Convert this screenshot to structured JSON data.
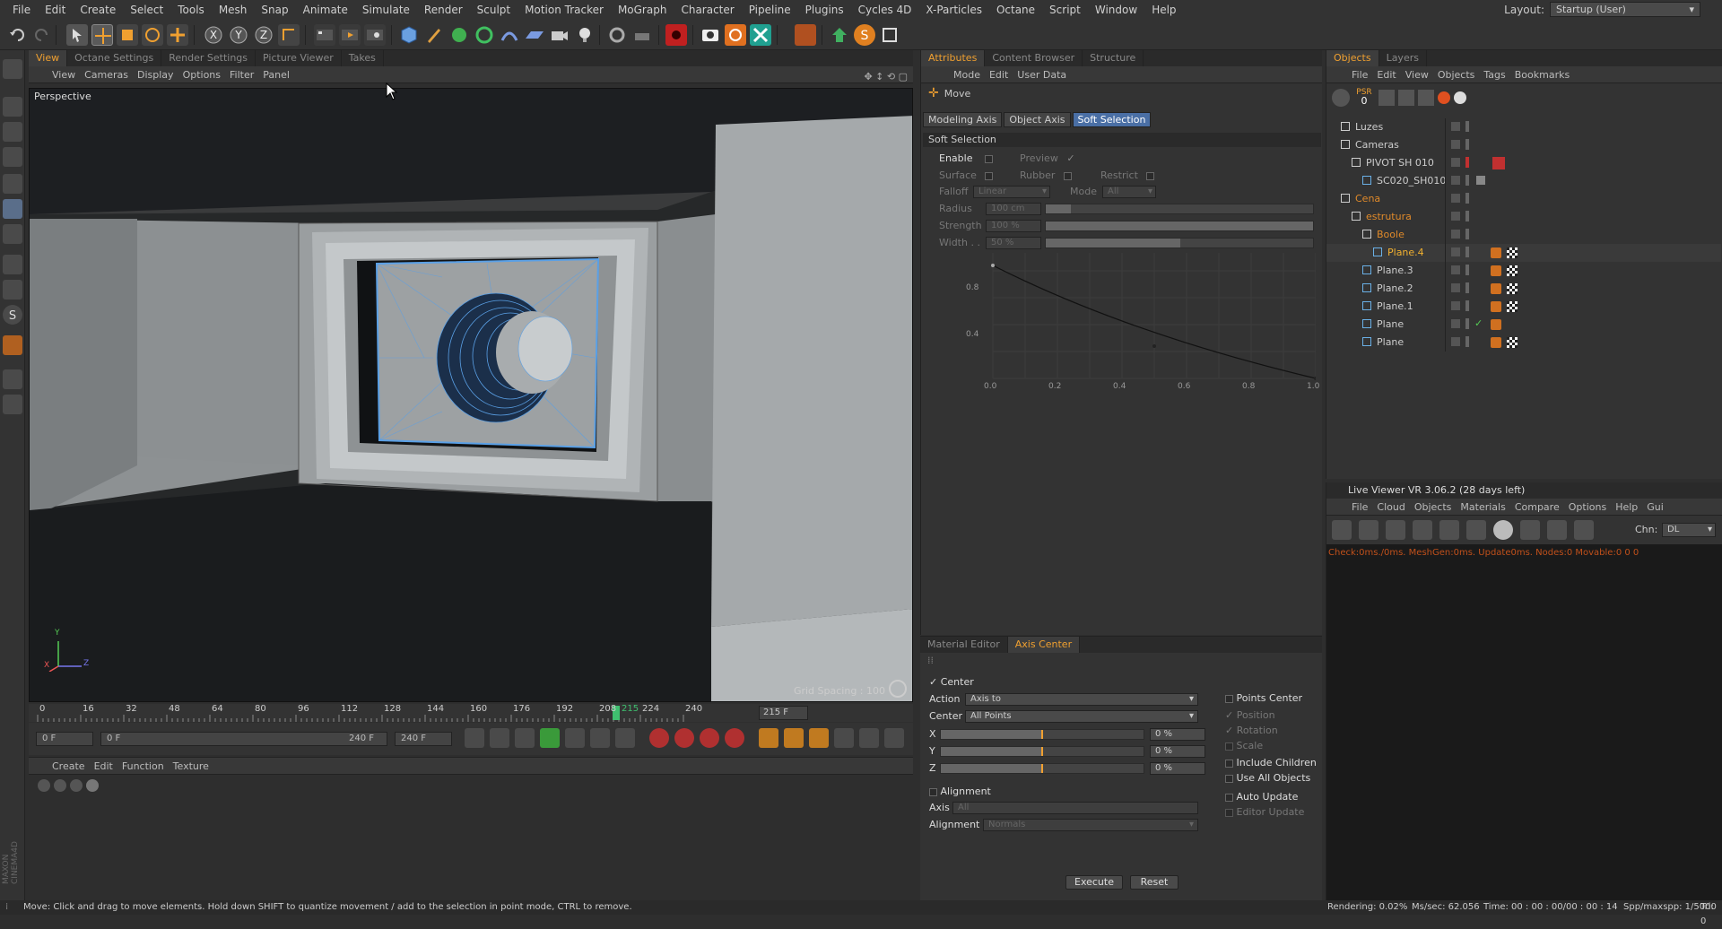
{
  "menubar": {
    "items": [
      "File",
      "Edit",
      "Create",
      "Select",
      "Tools",
      "Mesh",
      "Snap",
      "Animate",
      "Simulate",
      "Render",
      "Sculpt",
      "Motion Tracker",
      "MoGraph",
      "Character",
      "Pipeline",
      "Plugins",
      "Cycles 4D",
      "X-Particles",
      "Octane",
      "Script",
      "Window",
      "Help"
    ],
    "layout_label": "Layout:",
    "layout_value": "Startup (User)"
  },
  "viewport_panel": {
    "tabs": [
      "View",
      "Octane Settings",
      "Render Settings",
      "Picture Viewer",
      "Takes"
    ],
    "menu": [
      "View",
      "Cameras",
      "Display",
      "Options",
      "Filter",
      "Panel"
    ],
    "label": "Perspective",
    "grid_spacing": "Grid Spacing : 100",
    "axis_y": "Y",
    "axis_x": "X",
    "axis_z": "Z"
  },
  "timeline": {
    "ticks": [
      "0",
      "16",
      "32",
      "48",
      "64",
      "80",
      "96",
      "112",
      "128",
      "144",
      "160",
      "176",
      "192",
      "208",
      "224",
      "240"
    ],
    "playhead": "215",
    "current_frame": "215 F"
  },
  "transport": {
    "start_field": "0 F",
    "range_start": "0 F",
    "range_end": "240 F",
    "end_field": "240 F"
  },
  "material_panel": {
    "menu": [
      "Create",
      "Edit",
      "Function",
      "Texture"
    ]
  },
  "attributes": {
    "tabs": [
      "Attributes",
      "Content Browser",
      "Structure"
    ],
    "menu": [
      "Mode",
      "Edit",
      "User Data"
    ],
    "tool_name": "Move",
    "subtabs": [
      "Modeling Axis",
      "Object Axis",
      "Soft Selection"
    ],
    "section": "Soft Selection",
    "enable": "Enable",
    "preview": "Preview",
    "surface": "Surface",
    "rubber": "Rubber",
    "restrict": "Restrict",
    "falloff": "Falloff",
    "falloff_value": "Linear",
    "mode": "Mode",
    "mode_value": "All",
    "radius": "Radius",
    "radius_value": "100 cm",
    "strength": "Strength",
    "strength_value": "100 %",
    "width": "Width . .",
    "width_value": "50 %",
    "graph_y": [
      "0.8",
      "0.4"
    ],
    "graph_x": [
      "0.0",
      "0.2",
      "0.4",
      "0.6",
      "0.8",
      "1.0"
    ]
  },
  "axis_center": {
    "tabs": [
      "Material Editor",
      "Axis Center"
    ],
    "center": "Center",
    "action": "Action",
    "action_value": "Axis to",
    "center_label": "Center",
    "center_value": "All Points",
    "x": "X",
    "y": "Y",
    "z": "Z",
    "x_value": "0 %",
    "y_value": "0 %",
    "z_value": "0 %",
    "alignment": "Alignment",
    "axis": "Axis",
    "axis_value": "All",
    "alignment_label": "Alignment",
    "alignment_value": "Normals",
    "points_center": "Points Center",
    "position": "Position",
    "rotation": "Rotation",
    "scale": "Scale",
    "include_children": "Include Children",
    "use_all_objects": "Use All Objects",
    "auto_update": "Auto Update",
    "editor_update": "Editor Update",
    "execute": "Execute",
    "reset": "Reset"
  },
  "objects": {
    "tabs": [
      "Objects",
      "Layers"
    ],
    "menu": [
      "File",
      "Edit",
      "View",
      "Objects",
      "Tags",
      "Bookmarks"
    ],
    "psr": "PSR",
    "psr_count": "0",
    "items": [
      {
        "name": "Luzes",
        "color": "#cccccc"
      },
      {
        "name": "Cameras",
        "color": "#cccccc"
      },
      {
        "name": "PIVOT SH 010",
        "color": "#cccccc"
      },
      {
        "name": "SC020_SH010",
        "color": "#cccccc"
      },
      {
        "name": "Cena",
        "color": "#e08a2a"
      },
      {
        "name": "estrutura",
        "color": "#e08a2a"
      },
      {
        "name": "Boole",
        "color": "#e08a2a"
      },
      {
        "name": "Plane.4",
        "color": "#f0b030"
      },
      {
        "name": "Plane.3",
        "color": "#cccccc"
      },
      {
        "name": "Plane.2",
        "color": "#cccccc"
      },
      {
        "name": "Plane.1",
        "color": "#cccccc"
      },
      {
        "name": "Plane",
        "color": "#cccccc"
      },
      {
        "name": "Plane",
        "color": "#cccccc"
      }
    ]
  },
  "live_viewer": {
    "title": "Live Viewer VR 3.06.2 (28 days left)",
    "menu": [
      "File",
      "Cloud",
      "Objects",
      "Materials",
      "Compare",
      "Options",
      "Help",
      "Gui"
    ],
    "chn_label": "Chn:",
    "chn_value": "DL",
    "status": "Check:0ms./0ms. MeshGen:0ms. Update0ms. Nodes:0 Movable:0  0 0"
  },
  "statusbar": {
    "message": "Move: Click and drag to move elements. Hold down SHIFT to quantize movement / add to the selection in point mode, CTRL to remove.",
    "rendering": "Rendering: 0.02%",
    "mssec": "Ms/sec: 62.056",
    "time": "Time: 00 : 00 : 00/00 : 00 : 14",
    "spp": "Spp/maxspp: 1/5000",
    "tri": "Tri: 0"
  },
  "brand": "MAXON CINEMA4D",
  "colors": {
    "accent": "#f0a030",
    "selected_tab": "#4a6fa5",
    "wire": "#5aa0e6"
  }
}
